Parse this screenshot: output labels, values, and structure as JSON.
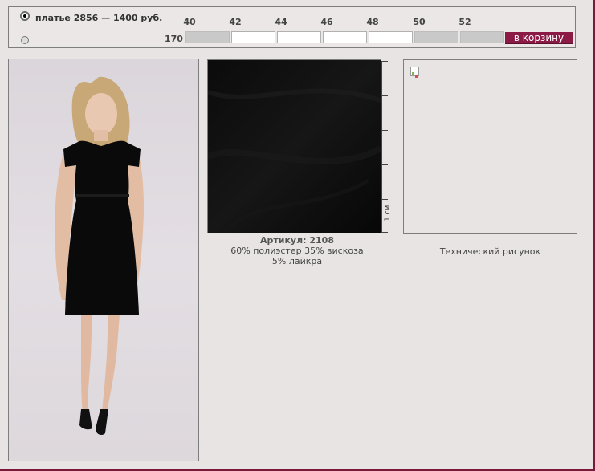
{
  "order": {
    "product_text": "платье  2856 — 1400 руб.",
    "sizes": [
      "40",
      "42",
      "44",
      "46",
      "48",
      "50",
      "52"
    ],
    "height": "170",
    "cart_label": "в корзину"
  },
  "fabric": {
    "sku": "Артикул: 2108",
    "composition_line1": "60% полиэстер 35% вискоза",
    "composition_line2": "5% лайкра",
    "ruler_label": "1 см"
  },
  "tech": {
    "caption": "Технический рисунок"
  },
  "colors": {
    "accent": "#8b1a45",
    "background": "#e8e4e4",
    "fabric": "#050505"
  }
}
